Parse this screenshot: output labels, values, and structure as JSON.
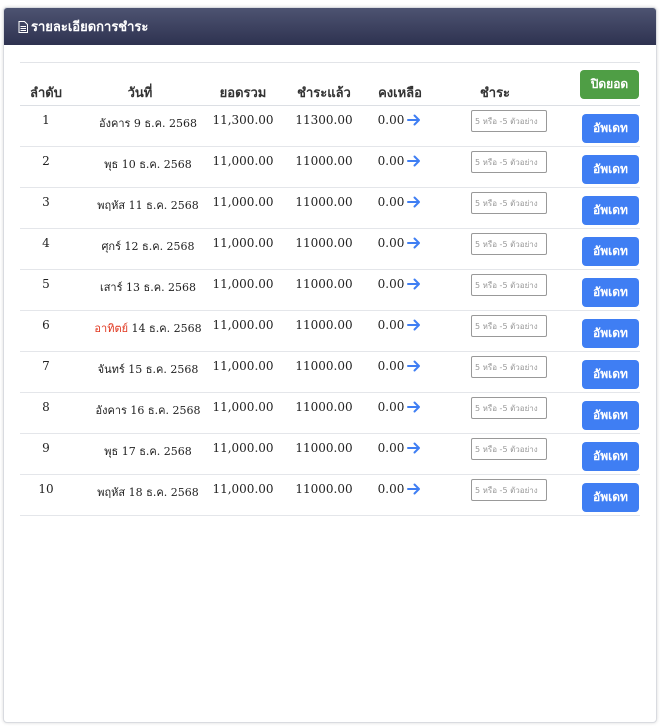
{
  "header": {
    "title": "รายละเอียดการชำระ",
    "icon": "document-icon"
  },
  "columns": {
    "no": "ลำดับ",
    "date": "วันที่",
    "total": "ยอดรวม",
    "paid": "ชำระแล้ว",
    "remaining": "คงเหลือ",
    "pay": "ชำระ"
  },
  "close_button_label": "ปิดยอด",
  "update_button_label": "อัพเดท",
  "pay_placeholder": "5 หรือ -5 ตัวอย่าง",
  "colors": {
    "header": "#3a3f5c",
    "update": "#3f7ef3",
    "close": "#4f9e45",
    "sunday": "#e0341c"
  },
  "rows": [
    {
      "no": "1",
      "day": "อังคาร",
      "date": "9 ธ.ค. 2568",
      "total": "11,300.00",
      "paid": "11300.00",
      "remaining": "0.00"
    },
    {
      "no": "2",
      "day": "พุธ",
      "date": "10 ธ.ค. 2568",
      "total": "11,000.00",
      "paid": "11000.00",
      "remaining": "0.00"
    },
    {
      "no": "3",
      "day": "พฤหัส",
      "date": "11 ธ.ค. 2568",
      "total": "11,000.00",
      "paid": "11000.00",
      "remaining": "0.00"
    },
    {
      "no": "4",
      "day": "ศุกร์",
      "date": "12 ธ.ค. 2568",
      "total": "11,000.00",
      "paid": "11000.00",
      "remaining": "0.00"
    },
    {
      "no": "5",
      "day": "เสาร์",
      "date": "13 ธ.ค. 2568",
      "total": "11,000.00",
      "paid": "11000.00",
      "remaining": "0.00"
    },
    {
      "no": "6",
      "day": "อาทิตย์",
      "date": "14 ธ.ค. 2568",
      "total": "11,000.00",
      "paid": "11000.00",
      "remaining": "0.00"
    },
    {
      "no": "7",
      "day": "จันทร์",
      "date": "15 ธ.ค. 2568",
      "total": "11,000.00",
      "paid": "11000.00",
      "remaining": "0.00"
    },
    {
      "no": "8",
      "day": "อังคาร",
      "date": "16 ธ.ค. 2568",
      "total": "11,000.00",
      "paid": "11000.00",
      "remaining": "0.00"
    },
    {
      "no": "9",
      "day": "พุธ",
      "date": "17 ธ.ค. 2568",
      "total": "11,000.00",
      "paid": "11000.00",
      "remaining": "0.00"
    },
    {
      "no": "10",
      "day": "พฤหัส",
      "date": "18 ธ.ค. 2568",
      "total": "11,000.00",
      "paid": "11000.00",
      "remaining": "0.00"
    }
  ]
}
